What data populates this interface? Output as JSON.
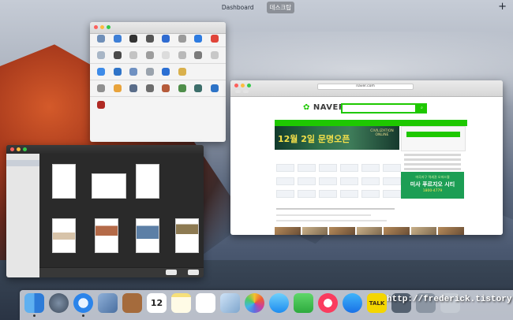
{
  "spaces": {
    "tabs": [
      "Dashboard",
      "데스크탑"
    ],
    "active_index": 1,
    "add_label": "+"
  },
  "browser": {
    "address": "naver.com",
    "naver_logo": "NAVER",
    "banner_text": "12월 2일 문명오픈",
    "banner_game": "CIVILIZATION ONLINE",
    "ad_promo": {
      "line1": "마곡지구 역세권 오피스텔",
      "line2": "미사 푸르지오 시티",
      "line3": "1800-4779"
    }
  },
  "watermark": "http://frederick.tistory.com",
  "dock": {
    "calendar_day": "12",
    "talk_label": "TALK"
  },
  "colors": {
    "naver_green": "#1ec800",
    "close": "#fc605c",
    "minimize": "#fdbc40",
    "zoom": "#34c84a"
  }
}
